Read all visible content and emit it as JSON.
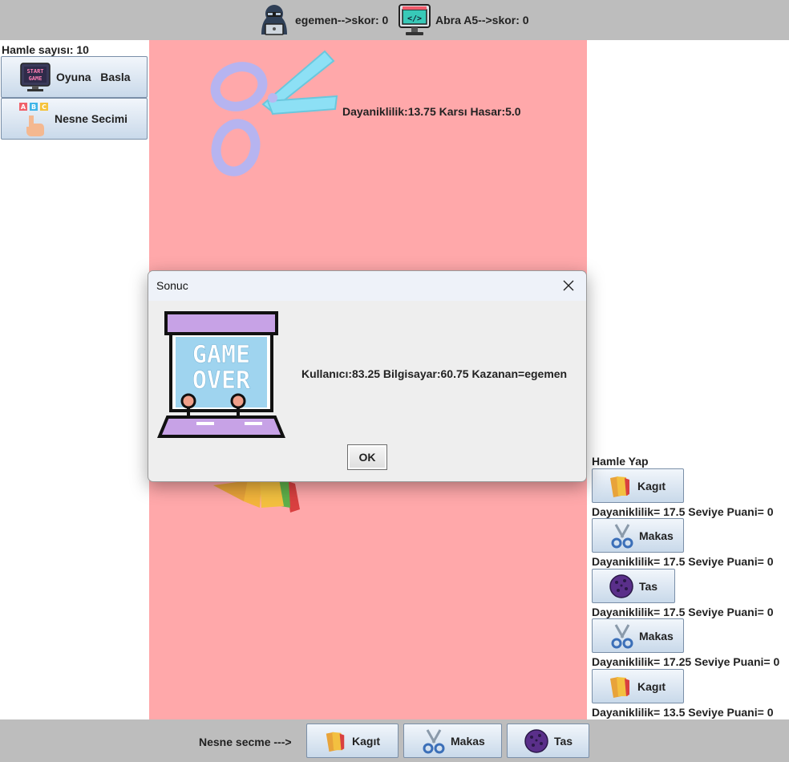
{
  "header": {
    "player": "egemen-->skor: 0",
    "computer": "Abra A5-->skor: 0",
    "player_icon": "hacker-avatar-icon",
    "computer_icon": "code-monitor-icon"
  },
  "sidebar": {
    "move_count": "Hamle sayısı: 10",
    "start_button": "Oyuna   Basla",
    "select_button": "Nesne Secimi"
  },
  "arena": {
    "top_stats": "Dayaniklilik:13.75 Karsı Hasar:5.0",
    "top_icon": "scissors-icon",
    "bottom_icon": "paper-stack-icon"
  },
  "moves": {
    "title": "Hamle Yap",
    "items": [
      {
        "label": "Kagıt",
        "icon": "paper-icon",
        "stats": "Dayaniklilik= 17.5 Seviye Puani= 0"
      },
      {
        "label": "Makas",
        "icon": "scissors-icon",
        "stats": "Dayaniklilik= 17.5 Seviye Puani= 0"
      },
      {
        "label": "Tas",
        "icon": "rock-icon",
        "stats": "Dayaniklilik= 17.5 Seviye Puani= 0"
      },
      {
        "label": "Makas",
        "icon": "scissors-icon",
        "stats": "Dayaniklilik= 17.25 Seviye Puani= 0"
      },
      {
        "label": "Kagıt",
        "icon": "paper-icon",
        "stats": "Dayaniklilik= 13.5 Seviye Puani= 0"
      }
    ]
  },
  "footer": {
    "prompt": "Nesne secme --->",
    "buttons": [
      {
        "label": "Kagıt",
        "icon": "paper-icon"
      },
      {
        "label": "Makas",
        "icon": "scissors-icon"
      },
      {
        "label": "Tas",
        "icon": "rock-icon"
      }
    ]
  },
  "dialog": {
    "title": "Sonuc",
    "message": "Kullanıcı:83.25 Bilgisayar:60.75 Kazanan=egemen",
    "ok": "OK",
    "image_icon": "game-over-arcade-icon",
    "image_text": "GAME OVER"
  },
  "colors": {
    "arena": "#ffa8aa",
    "bars": "#bdbdbd",
    "button_top": "#f2f6fb",
    "button_bottom": "#c9d9ea"
  }
}
